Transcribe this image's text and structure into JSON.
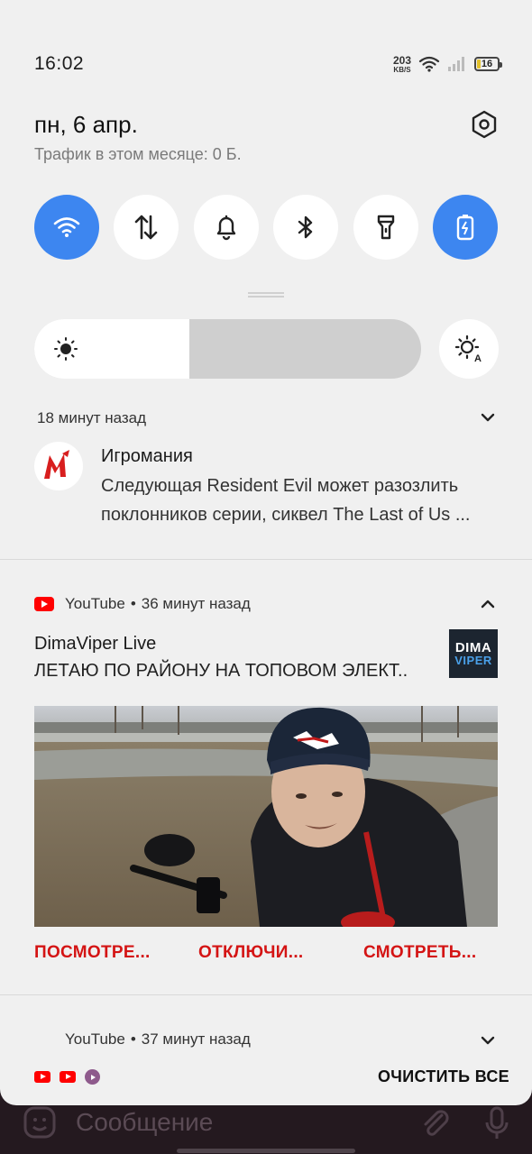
{
  "status_bar": {
    "time": "16:02",
    "net_speed_value": "203",
    "net_speed_unit": "KB/S",
    "battery_level": "16",
    "icons": [
      "wifi-icon",
      "signal-icon",
      "battery-icon"
    ]
  },
  "header": {
    "date": "пн, 6 апр.",
    "traffic": "Трафик в этом месяце: 0 Б.",
    "settings_icon": "settings-hex-icon"
  },
  "quick_tiles": [
    {
      "name": "wifi",
      "icon": "wifi-icon",
      "active": true
    },
    {
      "name": "mobile-data",
      "icon": "data-arrows-icon",
      "active": false
    },
    {
      "name": "sound",
      "icon": "bell-icon",
      "active": false
    },
    {
      "name": "bluetooth",
      "icon": "bluetooth-icon",
      "active": false
    },
    {
      "name": "flashlight",
      "icon": "flashlight-icon",
      "active": false
    },
    {
      "name": "battery-saver",
      "icon": "battery-icon",
      "active": true
    }
  ],
  "brightness": {
    "level_percent": 40,
    "auto_icon": "auto-brightness-icon"
  },
  "colors": {
    "accent": "#3d86f0",
    "action_red": "#d41414",
    "youtube_red": "#ff0000",
    "shade_bg": "#f0f0f0"
  },
  "notifications": [
    {
      "time": "18 минут назад",
      "app": "Игромания",
      "lines": [
        "Следующая Resident Evil может разозлить",
        "поклонников серии, сиквел The Last of Us ..."
      ]
    },
    {
      "app": "YouTube",
      "time": "36 минут назад",
      "title": "DimaViper Live",
      "text": "ЛЕТАЮ ПО РАЙОНУ НА ТОПОВОМ ЭЛЕКТ..",
      "thumb_line1": "DIMA",
      "thumb_line2": "VIPER",
      "actions": [
        "ПОСМОТРЕ...",
        "ОТКЛЮЧИ...",
        "СМОТРЕТЬ..."
      ]
    },
    {
      "app": "YouTube",
      "time": "37 минут назад"
    }
  ],
  "footer": {
    "clear_all": "ОЧИСТИТЬ ВСЕ"
  },
  "background_app": {
    "message_placeholder": "Сообщение"
  },
  "separator": "•"
}
